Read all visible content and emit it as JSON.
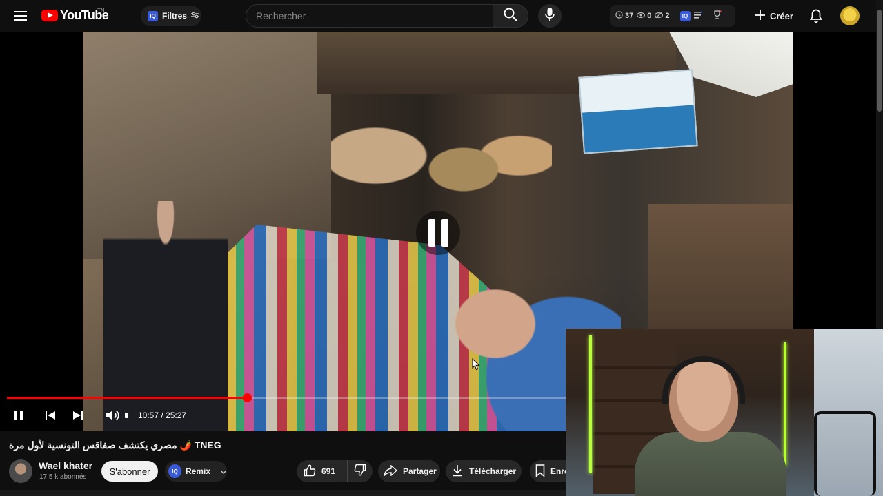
{
  "header": {
    "logo_text": "YouTube",
    "country_code": "TN",
    "filters_badge": "IQ",
    "filters_label": "Filtres",
    "search_placeholder": "Rechercher",
    "stats": {
      "clock_value": "37",
      "eye_value": "0",
      "eye_slash_value": "2",
      "iq_badge": "IQ"
    },
    "create_label": "Créer"
  },
  "player": {
    "time_current": "10:57",
    "time_total": "25:27",
    "time_display": "10:57 / 25:27",
    "progress_fraction": 0.43,
    "state": "playing"
  },
  "video": {
    "title": "مصري يكتشف صفاقس التونسية لأول مرة 🌶️ TNEG",
    "channel_name": "Wael khater",
    "subscribers": "17,5 k abonnés",
    "subscribe_label": "S'abonner",
    "remix_badge": "IQ",
    "remix_label": "Remix",
    "likes": "691",
    "share_label": "Partager",
    "download_label": "Télécharger",
    "save_label": "Enre"
  },
  "colors": {
    "accent": "#ff0000",
    "background": "#0f0f0f",
    "iq_badge": "#3a5bd9"
  },
  "icons": [
    "menu-icon",
    "search-icon",
    "mic-icon",
    "clock-icon",
    "eye-icon",
    "eye-slash-icon",
    "list-icon",
    "trophy-icon",
    "plus-icon",
    "bell-icon",
    "pause-icon",
    "previous-icon",
    "next-icon",
    "volume-icon",
    "thumbs-up-icon",
    "thumbs-down-icon",
    "share-icon",
    "download-icon",
    "bookmark-icon",
    "chevron-down-icon",
    "filter-icon"
  ]
}
